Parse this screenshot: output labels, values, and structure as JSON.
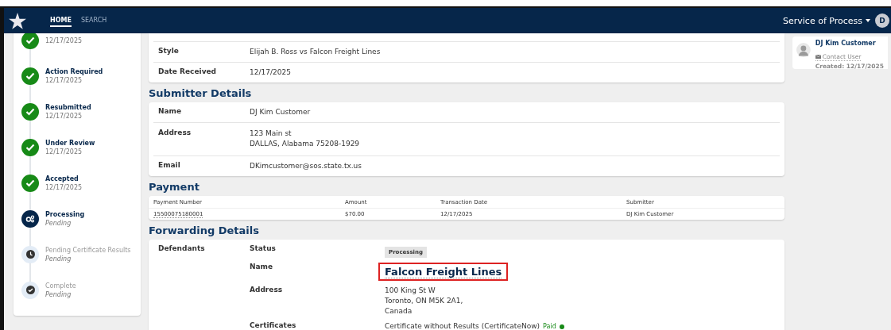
{
  "nav": {
    "tabs": [
      {
        "label": "HOME",
        "selected": true
      },
      {
        "label": "SEARCH",
        "selected": false
      }
    ],
    "menu": "Service of Process",
    "avatar": "D"
  },
  "timeline": [
    {
      "date": "12/17/2025",
      "kind": "done"
    },
    {
      "title": "Action Required",
      "date": "12/17/2025",
      "kind": "done"
    },
    {
      "title": "Resubmitted",
      "date": "12/17/2025",
      "kind": "done"
    },
    {
      "title": "Under Review",
      "date": "12/17/2025",
      "kind": "done"
    },
    {
      "title": "Accepted",
      "date": "12/17/2025",
      "kind": "done"
    },
    {
      "title": "Processing",
      "date": "Pending",
      "kind": "current"
    },
    {
      "title": "Pending Certificate Results",
      "date": "Pending",
      "kind": "waiting"
    },
    {
      "title": "Complete",
      "date": "Pending",
      "kind": "final"
    }
  ],
  "case_details": {
    "rows": [
      {
        "label": "Style",
        "lines": [
          "Elijah B. Ross vs Falcon Freight Lines"
        ]
      },
      {
        "label": "Date Received",
        "lines": [
          "12/17/2025"
        ]
      }
    ]
  },
  "submitter": {
    "title": "Submitter Details",
    "rows": [
      {
        "label": "Name",
        "lines": [
          "DJ Kim Customer"
        ]
      },
      {
        "label": "Address",
        "lines": [
          "123 Main st",
          "DALLAS, Alabama 75208-1929"
        ]
      },
      {
        "label": "Email",
        "lines": [
          "DKimcustomer@sos.state.tx.us"
        ]
      }
    ]
  },
  "payment": {
    "title": "Payment",
    "columns": [
      "Payment Number",
      "Amount",
      "Transaction Date",
      "Submitter"
    ],
    "rows": [
      [
        "15500075180001",
        "$70.00",
        "12/17/2025",
        "DJ Kim Customer"
      ]
    ]
  },
  "forwarding": {
    "title": "Forwarding Details",
    "party_label": "Defendants",
    "status_label": "Status",
    "status": "Processing",
    "name_label": "Name",
    "name": "Falcon Freight Lines",
    "name_highlighted": true,
    "address_label": "Address",
    "address": [
      "100 King St W",
      "Toronto, ON M5K 2A1,",
      "Canada"
    ],
    "certificates_label": "Certificates",
    "certificate": "Certificate without Results (CertificateNow)",
    "certificate_status": "Paid",
    "certificate_paid": true
  },
  "user_card": {
    "name": "DJ Kim Customer",
    "contact": "Contact User",
    "created": "Created: 12/17/2025"
  }
}
